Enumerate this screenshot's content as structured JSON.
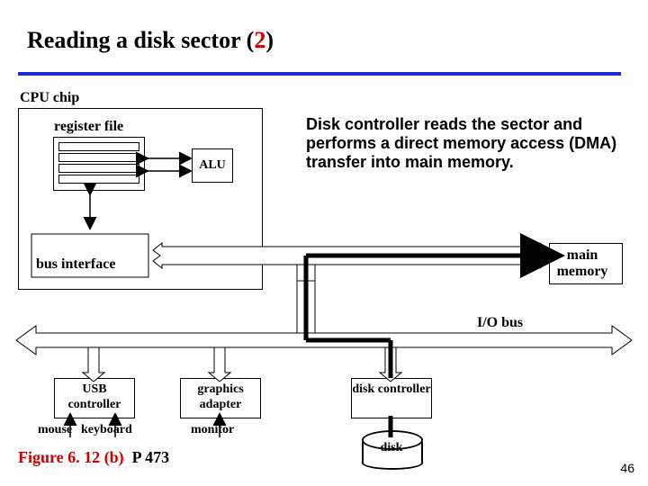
{
  "title_a": "Reading a disk sector (",
  "title_b": "2",
  "title_c": ")",
  "cpu_label": "CPU chip",
  "regfile_label": "register file",
  "alu_label": "ALU",
  "caption": "Disk controller reads the sector and performs a direct memory access (DMA) transfer into main memory.",
  "bus_interface_label": "bus interface",
  "main_memory_label": "main memory",
  "io_bus_label": "I/O bus",
  "devices": {
    "usb": "USB controller",
    "graphics": "graphics adapter",
    "diskc": "disk controller"
  },
  "peripherals": {
    "mouse": "mouse",
    "keyboard": "keyboard",
    "monitor": "monitor",
    "disk": "disk"
  },
  "figure_a": "Figure 6. 12 (b)",
  "figure_b": "P 473",
  "slide_number": "46"
}
